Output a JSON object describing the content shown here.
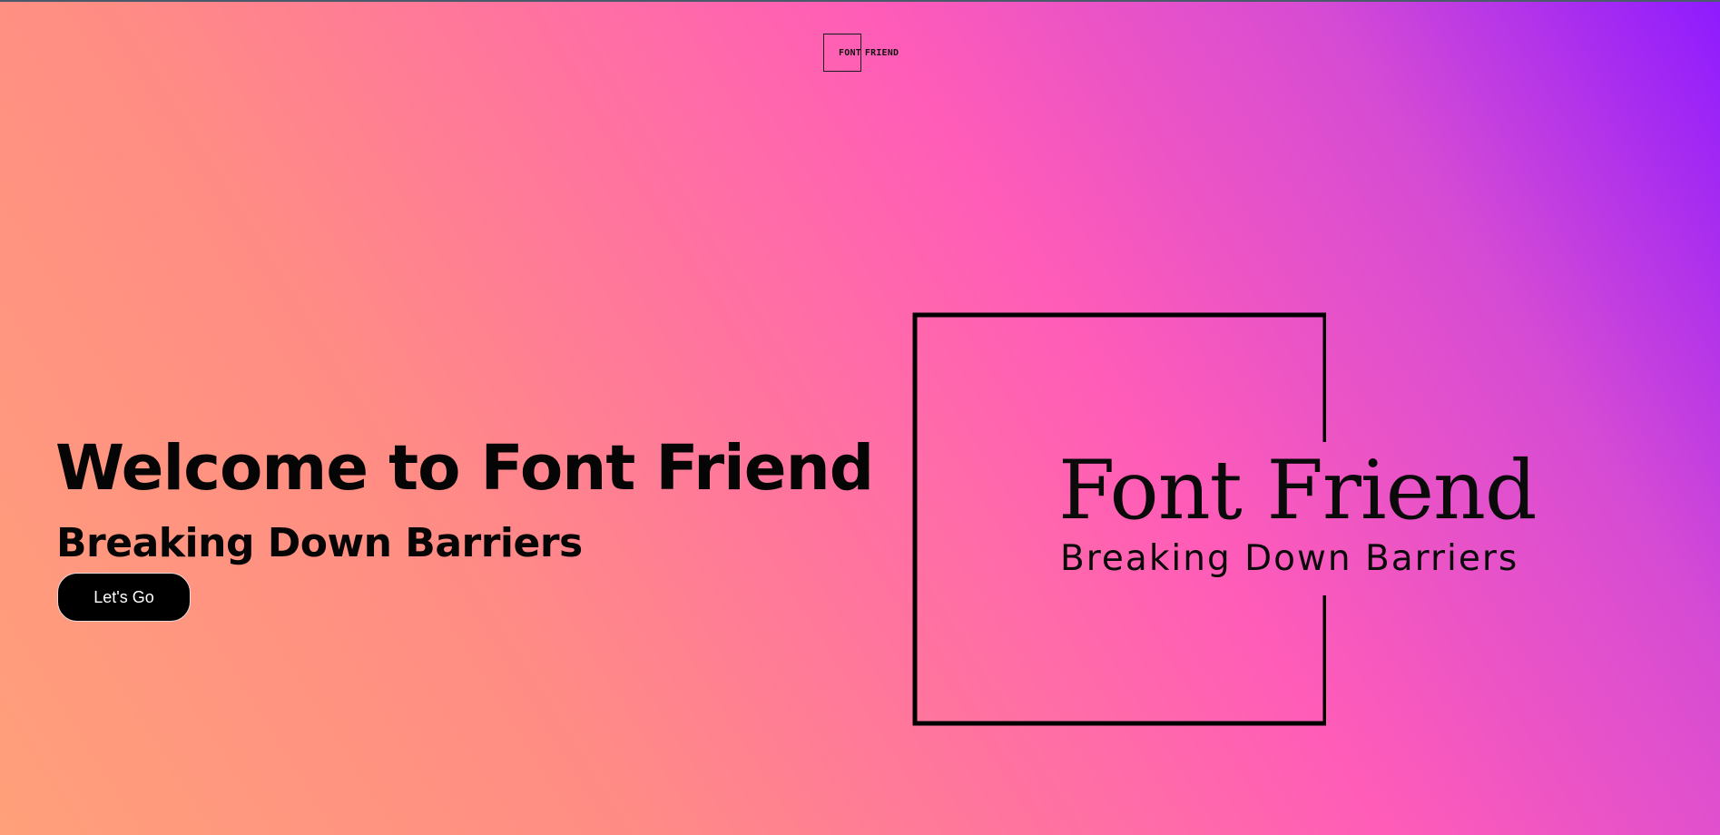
{
  "nav": {
    "logo_word1": "FONT",
    "logo_word2": "FRIEND"
  },
  "hero": {
    "title": "Welcome to Font Friend",
    "subtitle": "Breaking Down Barriers",
    "cta_label": "Let's Go"
  },
  "brand": {
    "name": "Font Friend",
    "tagline": "Breaking Down Barriers"
  },
  "colors": {
    "gradient_start": "#ffa07a",
    "gradient_mid": "#ff5cb8",
    "gradient_end": "#8e1bff",
    "text": "#050505",
    "button_bg": "#000000",
    "button_text": "#ffffff"
  }
}
